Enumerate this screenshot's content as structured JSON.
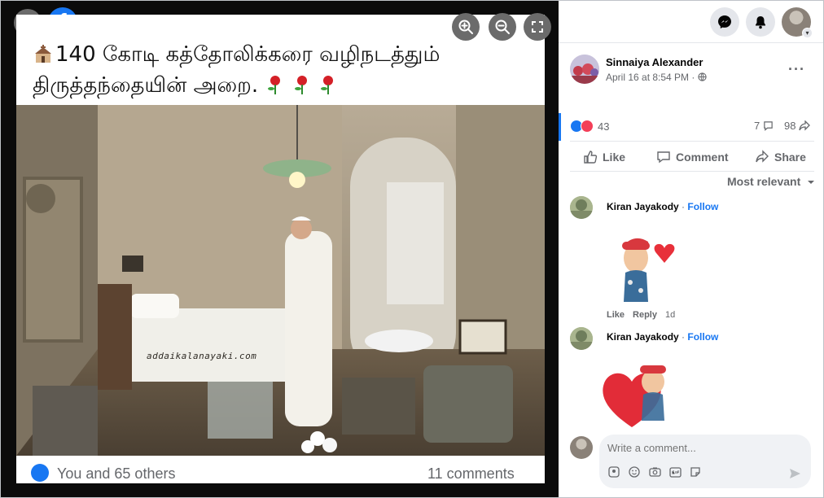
{
  "viewer": {
    "caption_line1": "140 கோடி கத்தோலிக்கரை வழிநடத்தும்",
    "caption_line2": "திருத்தந்தையின் அறை.",
    "watermark": "addaikalanayaki.com",
    "footer_likes": "You and 65 others",
    "footer_comments": "11 comments",
    "icons": [
      "close-icon",
      "facebook-logo",
      "zoom-in-icon",
      "zoom-out-icon",
      "fullscreen-icon"
    ]
  },
  "topbar": {
    "icons": [
      "messenger-icon",
      "notifications-icon",
      "account-avatar"
    ]
  },
  "post": {
    "author": "Sinnaiya Alexander",
    "date": "April 16 at 8:54 PM ·",
    "more": "···",
    "reaction_count": "43",
    "comment_count": "7",
    "share_count": "98",
    "actions": {
      "like": "Like",
      "comment": "Comment",
      "share": "Share"
    },
    "sort": "Most relevant"
  },
  "comments": [
    {
      "name": "Kiran Jayakody",
      "sep": " · ",
      "follow": "Follow",
      "like": "Like",
      "reply": "Reply",
      "time": "1d"
    },
    {
      "name": "Kiran Jayakody",
      "sep": " · ",
      "follow": "Follow"
    }
  ],
  "composer": {
    "placeholder": "Write a comment..."
  },
  "colors": {
    "accent": "#1877f2",
    "love": "#f33e58",
    "muted": "#65676b"
  }
}
